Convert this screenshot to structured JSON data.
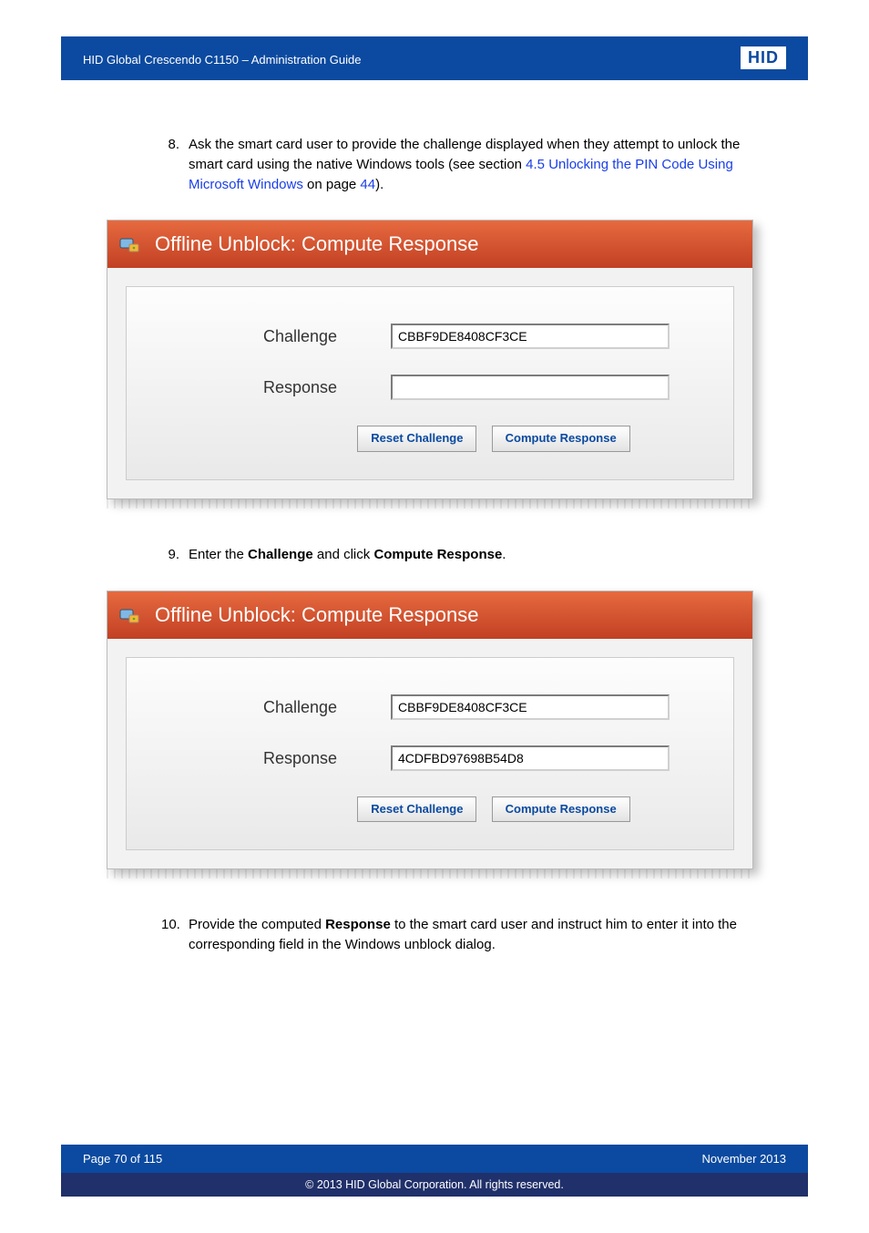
{
  "header": {
    "title": "HID Global Crescendo C1150  – Administration Guide",
    "logo": "HID"
  },
  "steps": {
    "s8": {
      "num": "8.",
      "text_a": "Ask the smart card user to provide the challenge displayed when they attempt to unlock the smart card using the native Windows tools (see section ",
      "link": "4.5 Unlocking the PIN Code Using Microsoft Windows",
      "text_b": " on page ",
      "link2": "44",
      "text_c": ")."
    },
    "s9": {
      "num": "9.",
      "text_a": "Enter the ",
      "bold_a": "Challenge",
      "text_b": " and click ",
      "bold_b": "Compute Response",
      "text_c": "."
    },
    "s10": {
      "num": "10.",
      "text_a": "Provide the computed ",
      "bold_a": "Response",
      "text_b": " to the smart card user and instruct him to enter it into the corresponding field in the Windows unblock dialog."
    }
  },
  "panel1": {
    "title": "Offline Unblock: Compute Response",
    "challenge_label": "Challenge",
    "challenge_value": "CBBF9DE8408CF3CE",
    "response_label": "Response",
    "response_value": "",
    "reset_btn": "Reset Challenge",
    "compute_btn": "Compute Response"
  },
  "panel2": {
    "title": "Offline Unblock: Compute Response",
    "challenge_label": "Challenge",
    "challenge_value": "CBBF9DE8408CF3CE",
    "response_label": "Response",
    "response_value": "4CDFBD97698B54D8",
    "reset_btn": "Reset Challenge",
    "compute_btn": "Compute Response"
  },
  "footer": {
    "page": "Page 70 of 115",
    "date": "November 2013",
    "copyright": "© 2013 HID Global Corporation. All rights reserved."
  }
}
